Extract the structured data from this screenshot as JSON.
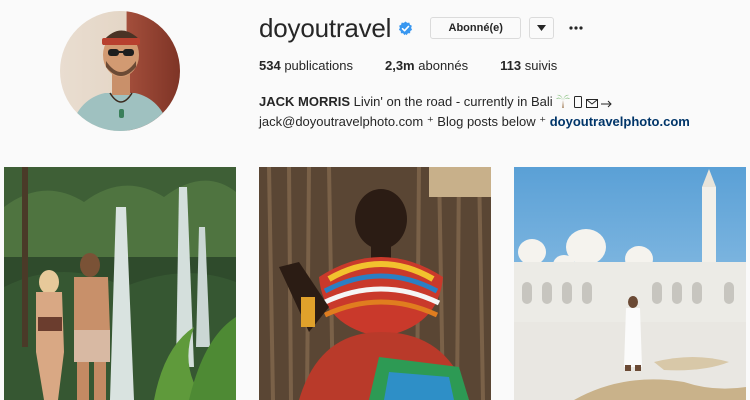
{
  "profile": {
    "username": "doyoutravel",
    "verified": true,
    "follow_label": "Abonné(e)",
    "stats": [
      {
        "value": "534",
        "label": "publications"
      },
      {
        "value": "2,3m",
        "label": "abonnés"
      },
      {
        "value": "113",
        "label": "suivis"
      }
    ],
    "bio_name": "JACK MORRIS",
    "bio_text": "Livin' on the road - currently in Bali",
    "bio_icons": [
      "palm-tree-icon",
      "phone-icon",
      "envelope-icon",
      "pointer-icon"
    ],
    "bio_line2": "jack@doyoutravelphoto.com ⁺ Blog posts below ⁺",
    "bio_link": "doyoutravelphoto.com"
  },
  "posts": [
    {
      "name": "waterfall-couple-photo"
    },
    {
      "name": "african-woman-beads-photo"
    },
    {
      "name": "mosque-man-photo"
    }
  ],
  "colors": {
    "verified": "#3897f0",
    "link": "#003569",
    "text": "#262626",
    "border": "#dbdbdb"
  }
}
